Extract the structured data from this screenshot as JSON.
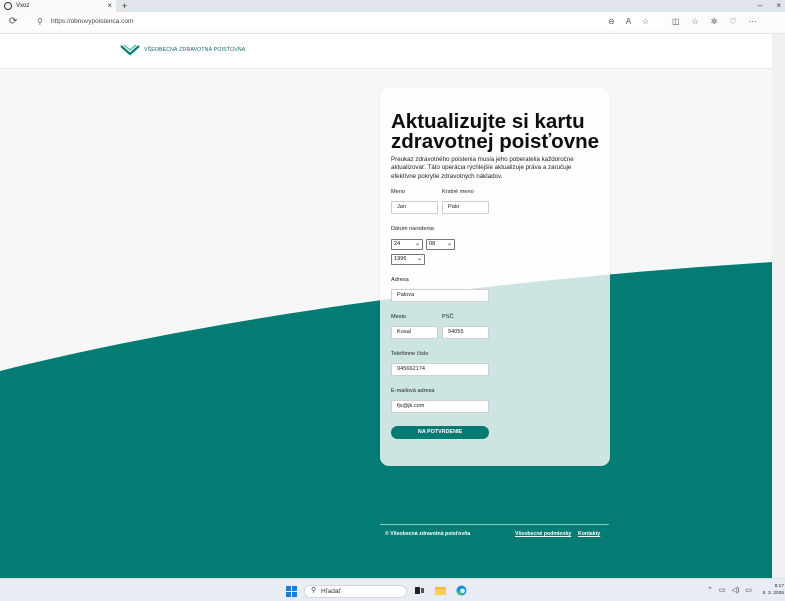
{
  "browser": {
    "tab_title": "Vxoz",
    "tab_close": "×",
    "new_tab": "+",
    "window_buttons": [
      "–",
      "×"
    ],
    "url": "https://obnovypoistenca.com"
  },
  "site": {
    "logo_text": "VŠEOBECNÁ ZDRAVOTNÁ POISŤOVŇA",
    "brand_color": "#037d74"
  },
  "form": {
    "title": "Aktualizujte si kartu zdravotnej poisťovne",
    "description": "Preukaz zdravotného poistenia musia jeho poberatelia každoročne aktualizovať. Táto operácia rýchlejšie aktualizuje práva a zaručuje efektívne pokrytie zdravotných nákladov.",
    "first_name": {
      "label": "Meno",
      "value": "Jan"
    },
    "last_name": {
      "label": "Krstné meno",
      "value": "Palo"
    },
    "dob": {
      "label": "Dátum narodenia",
      "day": "24",
      "month": "08",
      "year": "1996"
    },
    "address": {
      "label": "Adresa",
      "value": "Palova"
    },
    "city": {
      "label": "Mesto",
      "value": "Kosal"
    },
    "zip": {
      "label": "PSČ",
      "value": "94055"
    },
    "phone": {
      "label": "Telefónne číslo",
      "value": "945662174"
    },
    "email": {
      "label": "E-mailová adresa",
      "value": "fjs@jk.com"
    },
    "submit_label": "NA POTVRDENIE"
  },
  "footer": {
    "copyright": "© Všeobecná zdravotná poisťovňa",
    "links": [
      "Všeobecné podmienky",
      "Kontakty"
    ]
  },
  "taskbar": {
    "search_placeholder": "Hľadať",
    "time": "8:17",
    "date": "5. 3. 2025"
  }
}
